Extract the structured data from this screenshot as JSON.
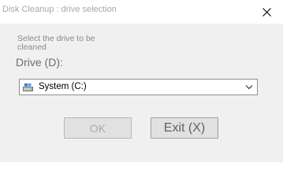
{
  "window": {
    "title": "Disk Cleanup : drive selection"
  },
  "dialog": {
    "prompt": "Select the drive to be cleaned",
    "drive_label": "Drive (D):",
    "selected_drive": "System (C:)",
    "ok_label": "OK",
    "exit_label": "Exit (X)"
  },
  "colors": {
    "title_text": "#a8a8a8",
    "client_background": "#f0f0f0",
    "button_face": "#e1e1e1",
    "disabled_text": "#a9a9a9"
  },
  "icons": {
    "close": "close-icon",
    "drive": "drive-icon",
    "dropdown": "chevron-down-icon"
  }
}
